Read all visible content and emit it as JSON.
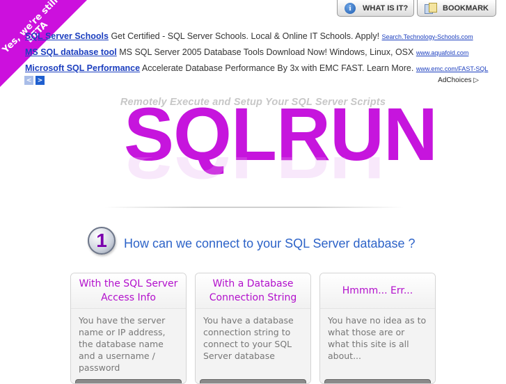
{
  "beta_ribbon": {
    "text": "Yes, we're still BETA"
  },
  "top_buttons": {
    "what_is_it": "WHAT IS IT?",
    "bookmark": "BOOKMARK"
  },
  "ads": [
    {
      "title": "SQL Server Schools",
      "text": "Get Certified - SQL Server Schools. Local & Online IT Schools. Apply!",
      "url": "Search.Technology-Schools.com"
    },
    {
      "title": "MS SQL database tool",
      "text": "MS SQL Server 2005 Database Tools Download Now! Windows, Linux, OSX",
      "url": "www.aquafold.com"
    },
    {
      "title": "Microsoft SQL Performance",
      "text": "Accelerate Database Performance By 3x with EMC FAST. Learn More.",
      "url": "www.emc.com/FAST-SQL"
    }
  ],
  "ad_nav": {
    "prev": "<",
    "next": ">"
  },
  "adchoices": "AdChoices ▷",
  "logo": {
    "tagline": "Remotely Execute and Setup Your SQL Server Scripts",
    "name": "SQLRUN"
  },
  "step": {
    "number": "1",
    "question": "How can we connect to your SQL Server database ?"
  },
  "options": [
    {
      "title": "With the SQL Server Access Info",
      "description": "You have the server name or IP address, the database name and a username / password"
    },
    {
      "title": "With a Database Connection String",
      "description": "You have a database connection string to connect to your SQL Server database"
    },
    {
      "title": "Hmmm... Err...",
      "description": "You have no idea as to what those are or what this site is all about..."
    }
  ],
  "colors": {
    "brand_magenta": "#c615dd",
    "link_blue": "#1c3fbf",
    "question_blue": "#2d63c8"
  }
}
